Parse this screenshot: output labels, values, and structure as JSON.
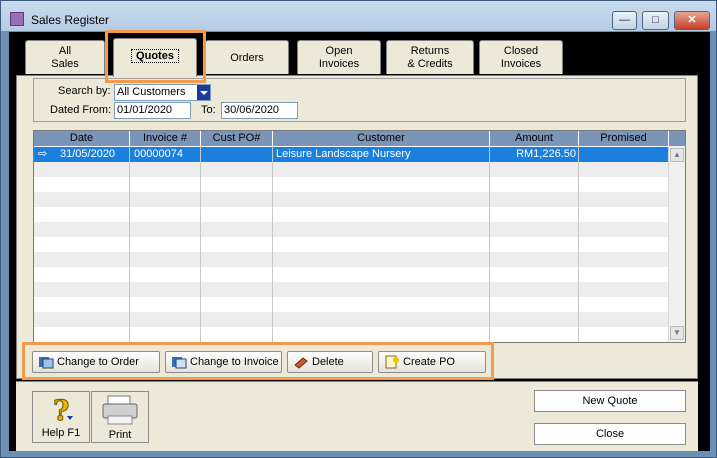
{
  "window": {
    "title": "Sales Register",
    "minimize_label": "—",
    "maximize_label": "□",
    "close_label": "✕"
  },
  "tabs": [
    {
      "label_line1": "All",
      "label_line2": "Sales"
    },
    {
      "label_line1": "Quotes",
      "label_line2": ""
    },
    {
      "label_line1": "Orders",
      "label_line2": ""
    },
    {
      "label_line1": "Open",
      "label_line2": "Invoices"
    },
    {
      "label_line1": "Returns",
      "label_line2": "& Credits"
    },
    {
      "label_line1": "Closed",
      "label_line2": "Invoices"
    }
  ],
  "active_tab": "Quotes",
  "search": {
    "search_by_label": "Search by:",
    "search_by_value": "All Customers",
    "dated_from_label": "Dated From:",
    "dated_from_value": "01/01/2020",
    "to_label": "To:",
    "to_value": "30/06/2020"
  },
  "table": {
    "columns": [
      "Date",
      "Invoice #",
      "Cust PO#",
      "Customer",
      "Amount",
      "Promised"
    ],
    "rows": [
      {
        "date": "31/05/2020",
        "invoice": "00000074",
        "cust_po": "",
        "customer": "Leisure Landscape Nursery",
        "amount": "RM1,226.50",
        "promised": "",
        "selected": true
      }
    ]
  },
  "actions": {
    "change_to_order": "Change to Order",
    "change_to_invoice": "Change to Invoice",
    "delete": "Delete",
    "create_po": "Create PO"
  },
  "footer": {
    "help_label": "Help F1",
    "print_label": "Print",
    "new_quote_label": "New Quote",
    "close_label": "Close"
  },
  "colors": {
    "highlight": "#f39a4c",
    "selected_row": "#1b7fde",
    "header_bg": "#7b95b8"
  },
  "icons": [
    "app-icon",
    "row-pointer-icon",
    "change-to-order-icon",
    "change-to-invoice-icon",
    "delete-icon",
    "create-po-icon",
    "help-icon",
    "print-icon"
  ]
}
